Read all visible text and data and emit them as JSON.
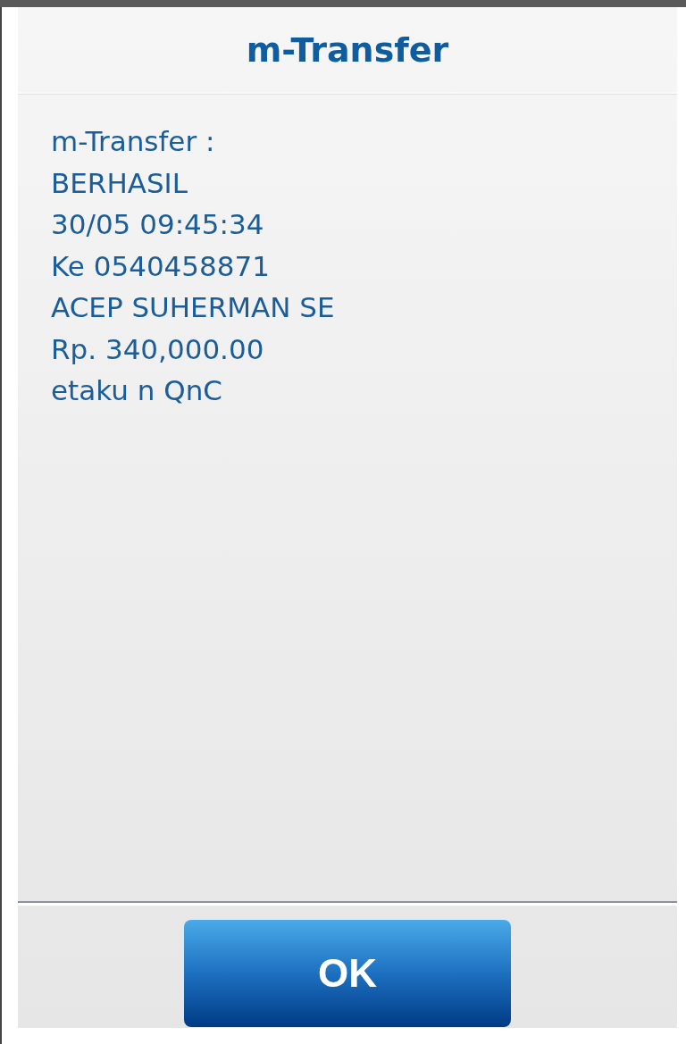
{
  "dialog": {
    "title": "m-Transfer",
    "message_lines": [
      "m-Transfer :",
      "BERHASIL",
      "30/05 09:45:34",
      "Ke 0540458871",
      "ACEP SUHERMAN SE",
      "Rp. 340,000.00",
      "etaku n QnC"
    ],
    "buttons": [
      {
        "label": "OK",
        "kind": "primary"
      }
    ]
  }
}
